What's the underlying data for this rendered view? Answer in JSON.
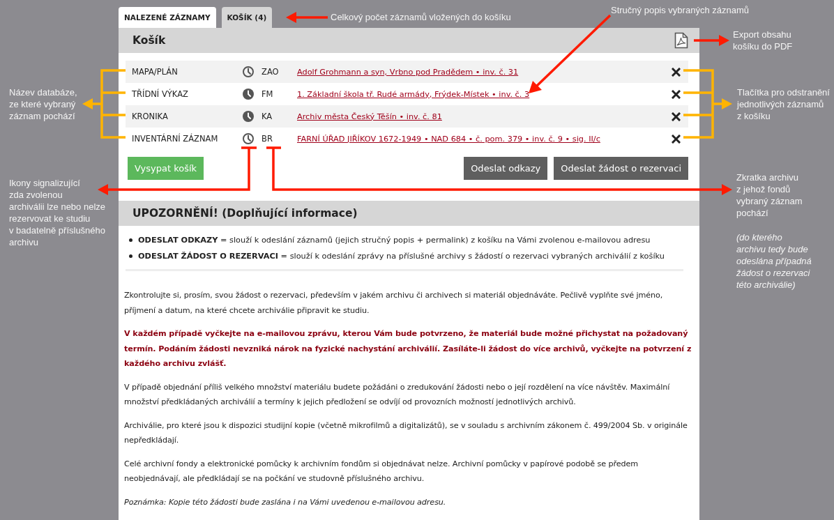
{
  "tabs": [
    {
      "label": "NALEZENÉ ZÁZNAMY",
      "selected": true
    },
    {
      "label": "KOŠÍK (4)",
      "selected": false
    }
  ],
  "basket": {
    "title": "Košík",
    "items": [
      {
        "database": "MAPA/PLÁN",
        "clock_solid": false,
        "archive": "ZAO",
        "description": "Adolf Grohmann a syn, Vrbno pod Pradědem • inv. č. 31"
      },
      {
        "database": "TŘÍDNÍ VÝKAZ",
        "clock_solid": true,
        "archive": "FM",
        "description": "1. Základní škola tř. Rudé armády, Frýdek-Místek • inv. č. 3"
      },
      {
        "database": "KRONIKA",
        "clock_solid": true,
        "archive": "KA",
        "description": "Archiv města Český Těšín • inv. č. 81"
      },
      {
        "database": "INVENTÁRNÍ ZÁZNAM",
        "clock_solid": false,
        "archive": "BR",
        "description": "FARNÍ ÚŘAD JIŘÍKOV 1672-1949 • NAD 684 • č. pom. 379 • inv. č. 9 • sig. II/c"
      }
    ],
    "buttons": [
      {
        "label": "Vysypat košík",
        "kind": "primary"
      },
      {
        "label": "Odeslat odkazy",
        "kind": "secondary"
      },
      {
        "label": "Odeslat žádost o rezervaci",
        "kind": "secondary"
      }
    ]
  },
  "notice": {
    "title": "UPOZORNĚNÍ! (Doplňující informace)",
    "bullets": [
      "**ODESLAT ODKAZY** = slouží k odeslání záznamů (jejich stručný popis + permalink) z košíku na Vámi zvolenou e-mailovou adresu",
      "**ODESLAT ŽÁDOST O REZERVACI** = slouží k odeslání zprávy na příslušné archivy s žádostí o rezervaci vybraných archiválií z košíku"
    ],
    "paragraphs": [
      {
        "kind": "normal",
        "text": "Zkontrolujte si, prosím, svou žádost o rezervaci, především v jakém archivu či archivech si materiál objednáváte. Pečlivě vyplňte své jméno, příjmení a datum, na které chcete archiválie připravit ke studiu."
      },
      {
        "kind": "warning",
        "text": "V každém případě vyčkejte na e-mailovou zprávu, kterou Vám bude potvrzeno, že materiál bude možné přichystat na požadovaný termín. Podáním žádosti nevzniká nárok na fyzické nachystání archiválií. Zasíláte-li žádost do více archivů, vyčkejte na potvrzení z každého archivu zvlášť."
      },
      {
        "kind": "normal",
        "text": "V případě objednání příliš velkého množství materiálu budete požádáni o zredukování žádosti nebo o její rozdělení na více návštěv. Maximální množství předkládaných archiválií a termíny k jejich předložení se odvíjí od provozních možností jednotlivých archivů."
      },
      {
        "kind": "normal",
        "text": "Archiválie, pro které jsou k dispozici studijní kopie (včetně mikrofilmů a digitalizátů), se v souladu s archivním zákonem č. 499/2004 Sb. v originále nepředkládají."
      },
      {
        "kind": "normal",
        "text": "Celé archivní fondy a elektronické pomůcky k archivním fondům si objednávat nelze. Archivní pomůcky v papírové podobě se předem neobjednávají, ale předkládají se na počkání ve studovně příslušného archivu."
      },
      {
        "kind": "note",
        "text": "Poznámka: Kopie této žádosti bude zaslána i na Vámi uvedenou e-mailovou adresu."
      }
    ]
  },
  "annotations": [
    {
      "lines": [
        "Celkový počet záznamů vložených do košíku"
      ]
    },
    {
      "lines": [
        "Stručný popis vybraných záznamů"
      ]
    },
    {
      "lines": [
        "Export obsahu",
        "košíku do PDF"
      ]
    },
    {
      "lines": [
        "Název databáze,",
        "ze které vybraný",
        "záznam pochází"
      ]
    },
    {
      "lines": [
        "Tlačítka pro odstranění",
        "jednotlivých záznamů",
        "z košíku"
      ]
    },
    {
      "lines": [
        "Ikony signalizující",
        "zda zvolenou",
        "archiválii lze nebo nelze",
        "rezervovat ke studiu",
        "v badatelně příslušného",
        "archivu"
      ]
    },
    {
      "lines": [
        "Zkratka archivu",
        "z jehož fondů",
        "vybraný záznam",
        "pochází"
      ],
      "note_lines": [
        "(do kterého",
        "archivu tedy bude",
        "odeslána případná",
        "žádost o rezervaci",
        "této archiválie)"
      ]
    }
  ]
}
